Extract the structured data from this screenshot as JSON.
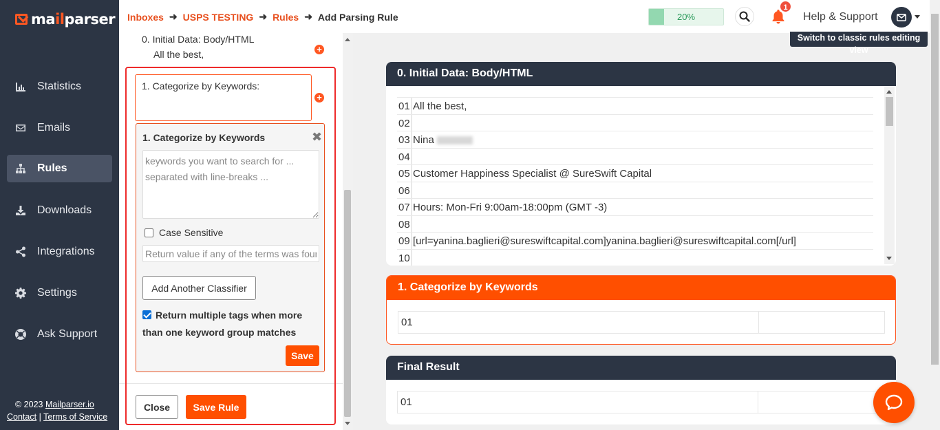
{
  "app": {
    "logo_prefix": "ma",
    "logo_accent": "il",
    "logo_suffix": "parser"
  },
  "sidebar": {
    "items": [
      {
        "label": "Statistics",
        "icon": "bar-chart-icon"
      },
      {
        "label": "Emails",
        "icon": "envelope-icon"
      },
      {
        "label": "Rules",
        "icon": "sitemap-icon",
        "active": true
      },
      {
        "label": "Downloads",
        "icon": "download-icon"
      },
      {
        "label": "Integrations",
        "icon": "share-icon"
      },
      {
        "label": "Settings",
        "icon": "gear-icon"
      },
      {
        "label": "Ask Support",
        "icon": "support-icon"
      }
    ],
    "copyright": "© 2023 ",
    "copyright_link": "Mailparser.io",
    "contact": "Contact",
    "separator": " | ",
    "terms": "Terms of Service"
  },
  "header": {
    "breadcrumbs": [
      "Inboxes",
      "USPS TESTING",
      "Rules"
    ],
    "current": "Add Parsing Rule",
    "progress_label": "20%",
    "progress_value": 0.2,
    "notification_count": "1",
    "help_label": "Help & Support"
  },
  "rules_panel": {
    "step0_title": "0. Initial Data: Body/HTML",
    "step0_preview": "All the best,",
    "step1_title": "1. Categorize by Keywords:",
    "editor": {
      "title": "1. Categorize by Keywords",
      "keywords_placeholder": "keywords you want to search for ... separated with line-breaks ...",
      "case_sensitive_label": "Case Sensitive",
      "return_placeholder": "Return value if any of the terms was found",
      "add_classifier_label": "Add Another Classifier",
      "multi_tags_label": "Return multiple tags when more than one keyword group matches",
      "multi_tags_checked": true,
      "save_label": "Save"
    },
    "close_label": "Close",
    "save_rule_label": "Save Rule"
  },
  "classic_view_label": "Switch to classic rules editing view",
  "preview": {
    "initial_title": "0. Initial Data: Body/HTML",
    "initial_lines": [
      {
        "num": "01",
        "text": "All the best,"
      },
      {
        "num": "02",
        "text": ""
      },
      {
        "num": "03",
        "text": "Nina"
      },
      {
        "num": "04",
        "text": ""
      },
      {
        "num": "05",
        "text": "Customer Happiness Specialist @ SureSwift Capital"
      },
      {
        "num": "06",
        "text": ""
      },
      {
        "num": "07",
        "text": "Hours: Mon-Fri 9:00am-18:00pm (GMT -3)"
      },
      {
        "num": "08",
        "text": ""
      },
      {
        "num": "09",
        "text": "[url=yanina.baglieri@sureswiftcapital.com]yanina.baglieri@sureswiftcapital.com[/url]"
      },
      {
        "num": "10",
        "text": ""
      }
    ],
    "categorize_title": "1. Categorize by Keywords",
    "categorize_row": "01",
    "final_title": "Final Result",
    "final_row": "01"
  },
  "colors": {
    "accent": "#ff4f00",
    "sidebar_bg": "#2c3544",
    "link": "#e8501f"
  }
}
